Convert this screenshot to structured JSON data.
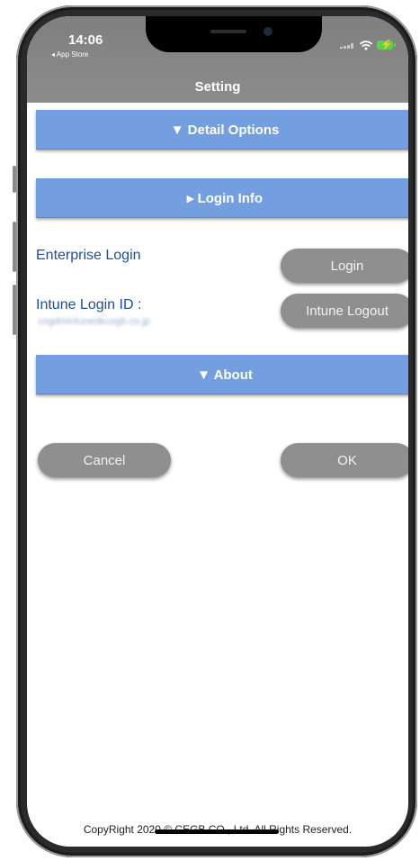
{
  "status_bar": {
    "time": "14:06",
    "back_app": "◂ App Store"
  },
  "nav": {
    "title": "Setting"
  },
  "sections": {
    "detail_options": "▼ Detail Options",
    "login_info": "▸ Login Info",
    "about": "▼ About"
  },
  "login": {
    "enterprise_label": "Enterprise Login",
    "login_button": "Login",
    "intune_label": "Intune Login ID :",
    "intune_value": "cogdmintunedkcogb.co.jp",
    "intune_logout_button": "Intune Logout"
  },
  "actions": {
    "cancel": "Cancel",
    "ok": "OK"
  },
  "footer": {
    "copyright": "CopyRight 2020 © CEGB CO., Ltd. All Rights Reserved."
  },
  "colors": {
    "section_bar": "#739fe0",
    "label_text": "#1d4f9a",
    "button_bg": "#8f8f8f",
    "status_bar_bg": "#858585",
    "battery": "#5fd14b"
  },
  "icons": [
    "cellular-signal-icon",
    "wifi-icon",
    "battery-charging-icon"
  ]
}
